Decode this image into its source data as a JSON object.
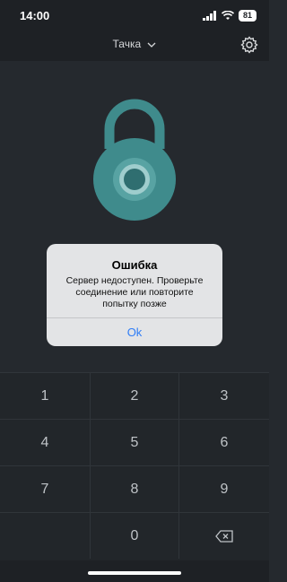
{
  "status_bar": {
    "time": "14:00",
    "battery": "81"
  },
  "header": {
    "title": "Тачка"
  },
  "keypad": {
    "keys": [
      "1",
      "2",
      "3",
      "4",
      "5",
      "6",
      "7",
      "8",
      "9",
      "",
      "0",
      ""
    ]
  },
  "alert": {
    "title": "Ошибка",
    "message": "Сервер недоступен. Проверьте соединение или повторите попытку позже",
    "ok_label": "Ok"
  },
  "colors": {
    "accent": "#2e7cf6",
    "lock": "#3f8b8c",
    "background": "#25292e"
  }
}
